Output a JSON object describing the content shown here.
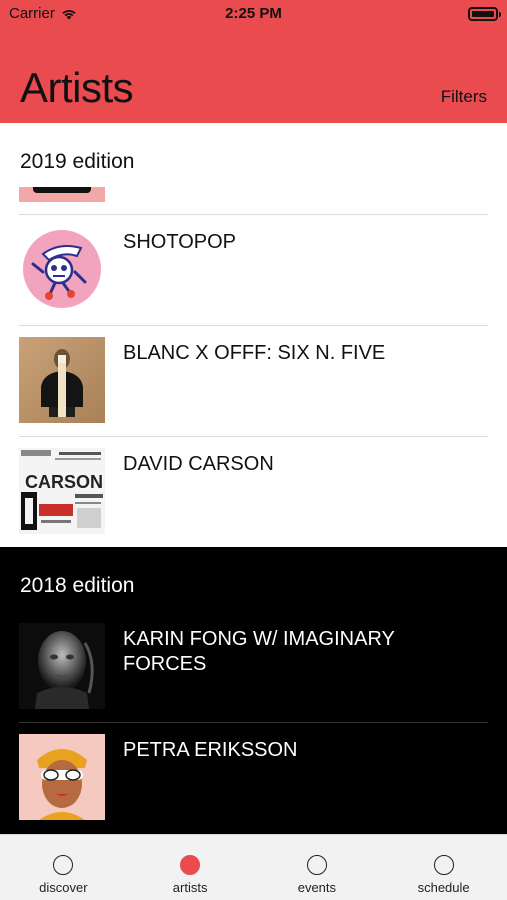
{
  "status": {
    "carrier": "Carrier",
    "time": "2:25 PM"
  },
  "header": {
    "title": "Artists",
    "filters_label": "Filters"
  },
  "sections": [
    {
      "title": "2019 edition",
      "artists": [
        {
          "name": "SHOTOPOP"
        },
        {
          "name": "BLANC X OFFF: SIX N. FIVE"
        },
        {
          "name": "DAVID CARSON"
        }
      ]
    },
    {
      "title": "2018 edition",
      "artists": [
        {
          "name": "KARIN FONG W/ IMAGINARY FORCES"
        },
        {
          "name": "PETRA ERIKSSON"
        }
      ]
    }
  ],
  "tabs": [
    {
      "label": "discover",
      "active": false
    },
    {
      "label": "artists",
      "active": true
    },
    {
      "label": "events",
      "active": false
    },
    {
      "label": "schedule",
      "active": false
    }
  ],
  "colors": {
    "accent": "#e94b4e",
    "dark_section": "#000000"
  }
}
